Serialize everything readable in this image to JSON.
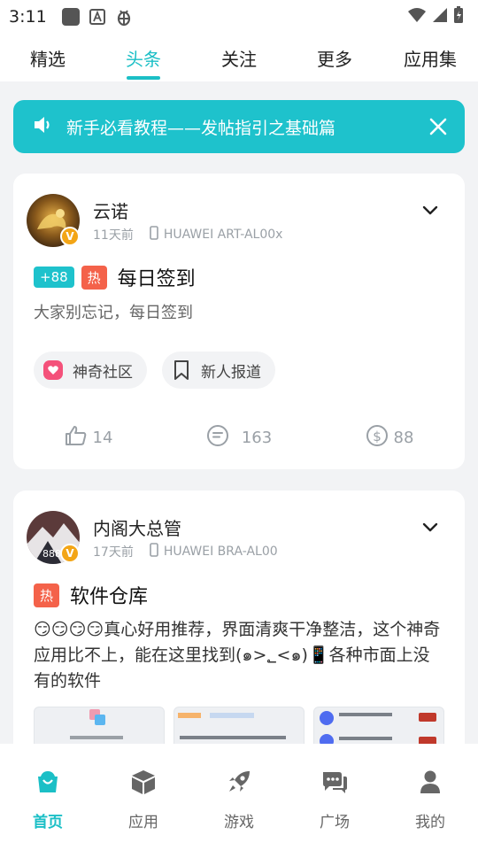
{
  "status": {
    "time": "3:11"
  },
  "tabs": [
    {
      "label": "精选",
      "active": false
    },
    {
      "label": "头条",
      "active": true
    },
    {
      "label": "关注",
      "active": false
    },
    {
      "label": "更多",
      "active": false
    },
    {
      "label": "应用集",
      "active": false
    }
  ],
  "notice": {
    "text": "新手必看教程——发帖指引之基础篇"
  },
  "posts": [
    {
      "author": "云诺",
      "time": "11天前",
      "device": "HUAWEI ART-AL00x",
      "plus": "+88",
      "hot": "热",
      "title": "每日签到",
      "body": "大家别忘记，每日签到",
      "chips": [
        "神奇社区",
        "新人报道"
      ],
      "likes": "14",
      "comments": "163",
      "coins": "88"
    },
    {
      "author": "内阁大总管",
      "time": "17天前",
      "device": "HUAWEI BRA-AL00",
      "hot": "热",
      "title": "软件仓库",
      "body": "😏😏😏😏真心好用推荐，界面清爽干净整洁，这个神奇应用比不上，能在这里找到(๑>؂<๑)📱各种市面上没有的软件"
    }
  ],
  "nav": [
    {
      "label": "首页",
      "active": true
    },
    {
      "label": "应用",
      "active": false
    },
    {
      "label": "游戏",
      "active": false
    },
    {
      "label": "广场",
      "active": false
    },
    {
      "label": "我的",
      "active": false
    }
  ],
  "colors": {
    "accent": "#1ec2cc",
    "hot": "#f4624a",
    "vip": "#f3a516"
  }
}
